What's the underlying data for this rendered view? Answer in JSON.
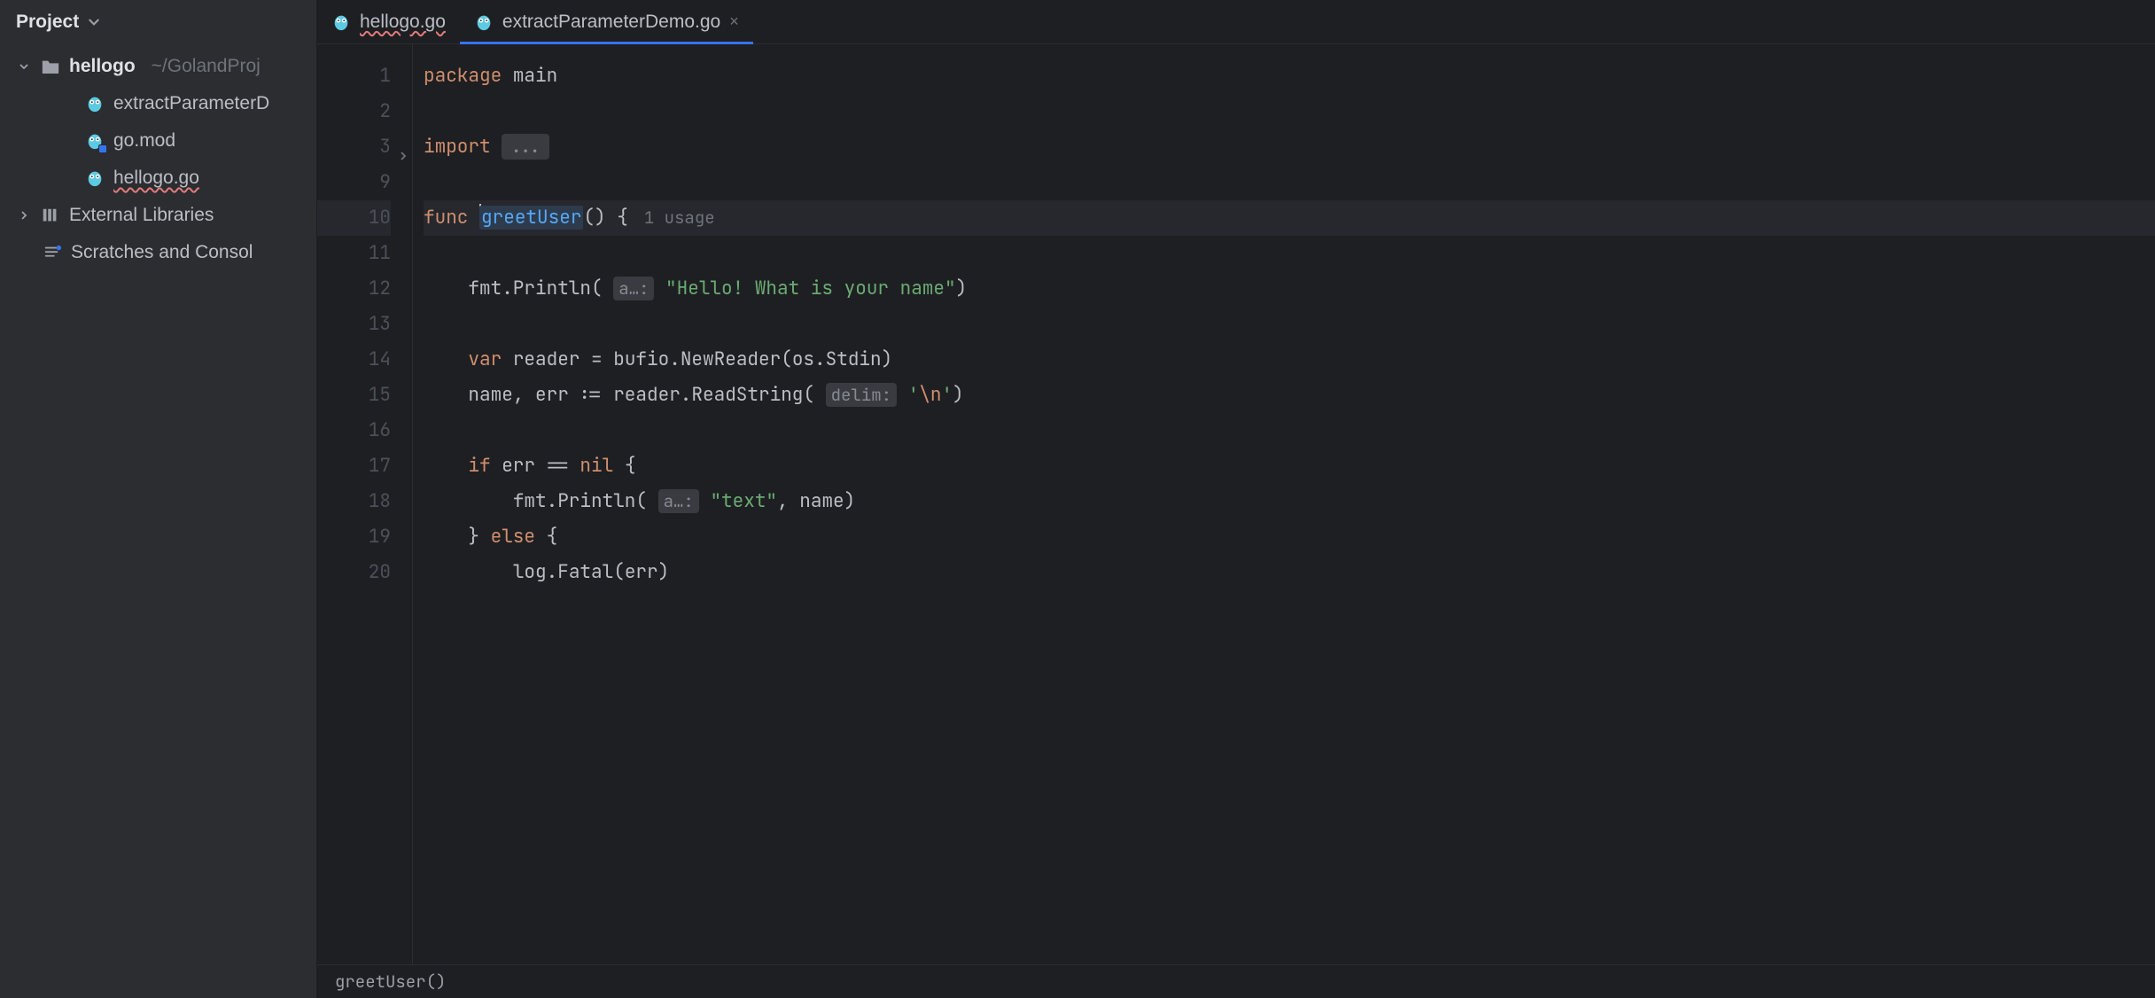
{
  "sidebar": {
    "title": "Project",
    "root": {
      "name": "hellogo",
      "path": "~/GolandProj"
    },
    "files": [
      {
        "name": "extractParameterD",
        "kind": "go"
      },
      {
        "name": "go.mod",
        "kind": "mod"
      },
      {
        "name": "hellogo.go",
        "kind": "go",
        "squiggle": true
      }
    ],
    "externalLibs": "External Libraries",
    "scratches": "Scratches and Consol"
  },
  "tabs": [
    {
      "label": "hellogo.go",
      "squiggle": true,
      "active": false
    },
    {
      "label": "extractParameterDemo.go",
      "active": true,
      "closeable": true
    }
  ],
  "gutter": [
    "1",
    "2",
    "3",
    "9",
    "10",
    "11",
    "12",
    "13",
    "14",
    "15",
    "16",
    "17",
    "18",
    "19",
    "20"
  ],
  "foldAtIndex": 2,
  "code": {
    "l1": {
      "kw": "package",
      "id": "main"
    },
    "l3": {
      "kw": "import",
      "dots": "..."
    },
    "l10": {
      "kw": "func",
      "name": "greetUser",
      "paren": "() {",
      "usage": "1 usage"
    },
    "l12": {
      "call": "fmt.Println(",
      "hint": "a…:",
      "str": "\"Hello! What is your name\"",
      "close": ")"
    },
    "l14": {
      "kw": "var",
      "rest1": " reader = bufio.",
      "fn": "NewReader",
      "rest2": "(os.Stdin)"
    },
    "l15": {
      "lhs": "name, err := reader.",
      "fn": "ReadString",
      "open": "( ",
      "hint": "delim:",
      "sp": " ",
      "q1": "'",
      "esc": "\\n",
      "q2": "'",
      "close": ")"
    },
    "l17": {
      "kw": "if",
      "rest": " err == ",
      "nil": "nil",
      "brace": " {"
    },
    "l18": {
      "call": "fmt.Println(",
      "hint": "a…:",
      "str": "\"text\"",
      "rest": ", name)"
    },
    "l19": {
      "txt": "} ",
      "kw": "else",
      "brace": " {"
    },
    "l20": {
      "txt": "log.",
      "fn": "Fatal",
      "rest": "(err)"
    }
  },
  "breadcrumb": "greetUser()"
}
